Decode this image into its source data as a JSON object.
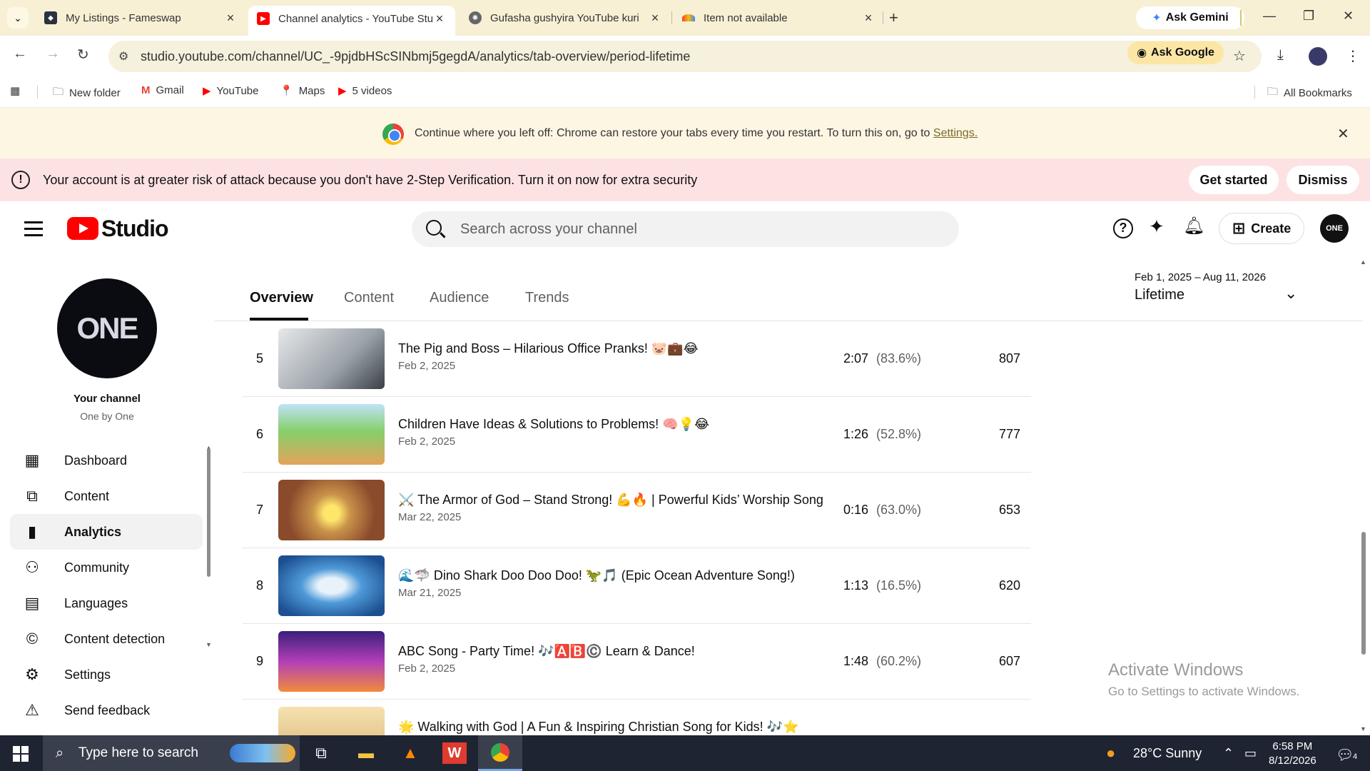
{
  "browser": {
    "tabs": [
      {
        "title": "My Listings - Fameswap",
        "active": false
      },
      {
        "title": "Channel analytics - YouTube Studio",
        "active": true
      },
      {
        "title": "Gufasha gushyira YouTube kuri",
        "active": false
      },
      {
        "title": "Item not available",
        "active": false
      }
    ],
    "ask_gemini": "Ask Gemini",
    "url": "studio.youtube.com/channel/UC_-9pjdbHScSINbmj5gegdA/analytics/tab-overview/period-lifetime",
    "ask_google": "Ask Google",
    "bookmarks": [
      "New folder",
      "Gmail",
      "YouTube",
      "Maps",
      "5 videos"
    ],
    "all_bookmarks": "All Bookmarks",
    "restore_message": "Continue where you left off: Chrome can restore your tabs every time you restart. To turn this on, go to",
    "restore_link": "Settings."
  },
  "warning": {
    "message": "Your account is at greater risk of attack because you don't have 2-Step Verification. Turn it on now for extra security",
    "get_started": "Get started",
    "dismiss": "Dismiss"
  },
  "studio": {
    "logo_text": "Studio",
    "search_placeholder": "Search across your channel",
    "create_label": "Create",
    "avatar_text": "ONE"
  },
  "sidebar": {
    "avatar_text": "ONE",
    "channel_label": "Your channel",
    "channel_name": "One by One",
    "items": [
      {
        "label": "Dashboard",
        "icon": "dashboard-icon"
      },
      {
        "label": "Content",
        "icon": "content-icon"
      },
      {
        "label": "Analytics",
        "icon": "analytics-icon",
        "active": true
      },
      {
        "label": "Community",
        "icon": "community-icon"
      },
      {
        "label": "Languages",
        "icon": "languages-icon"
      },
      {
        "label": "Content detection",
        "icon": "copyright-icon"
      },
      {
        "label": "Settings",
        "icon": "gear-icon"
      },
      {
        "label": "Send feedback",
        "icon": "feedback-icon"
      }
    ]
  },
  "analytics": {
    "tabs": [
      "Overview",
      "Content",
      "Audience",
      "Trends"
    ],
    "active_tab": "Overview",
    "date_range": "Feb 1, 2025 – Aug 11, 2026",
    "period": "Lifetime"
  },
  "videos": [
    {
      "rank": "5",
      "title": "The Pig and Boss – Hilarious Office Pranks! 🐷💼😂",
      "date": "Feb 2, 2025",
      "avg_duration": "2:07",
      "avg_pct": "(83.6%)",
      "views": "807",
      "thumb_color": "#d7d9dc"
    },
    {
      "rank": "6",
      "title": "Children Have Ideas & Solutions to Problems! 🧠💡😂",
      "date": "Feb 2, 2025",
      "avg_duration": "1:26",
      "avg_pct": "(52.8%)",
      "views": "777",
      "thumb_color": "#7cc46b"
    },
    {
      "rank": "7",
      "title": "⚔️ The Armor of God – Stand Strong! 💪🔥 | Powerful Kids’ Worship Song",
      "date": "Mar 22, 2025",
      "avg_duration": "0:16",
      "avg_pct": "(63.0%)",
      "views": "653",
      "thumb_color": "#9b5a3a"
    },
    {
      "rank": "8",
      "title": "🌊🦈 Dino Shark Doo Doo Doo! 🦖🎵 (Epic Ocean Adventure Song!)",
      "date": "Mar 21, 2025",
      "avg_duration": "1:13",
      "avg_pct": "(16.5%)",
      "views": "620",
      "thumb_color": "#2f7fc4"
    },
    {
      "rank": "9",
      "title": "ABC Song - Party Time! 🎶🅰️🅱️©️ Learn & Dance!",
      "date": "Feb 2, 2025",
      "avg_duration": "1:48",
      "avg_pct": "(60.2%)",
      "views": "607",
      "thumb_color": "#6a2fa0"
    },
    {
      "rank": "",
      "title": "🌟 Walking with God | A Fun & Inspiring Christian Song for Kids! 🎶⭐",
      "date": "",
      "avg_duration": "",
      "avg_pct": "",
      "views": "",
      "thumb_color": "#e9c98a"
    }
  ],
  "watermark": {
    "line1": "Activate Windows",
    "line2": "Go to Settings to activate Windows."
  },
  "taskbar": {
    "search_placeholder": "Type here to search",
    "weather": "28°C  Sunny",
    "time": "6:58 PM",
    "date": "8/12/2026",
    "notification_count": "4"
  }
}
